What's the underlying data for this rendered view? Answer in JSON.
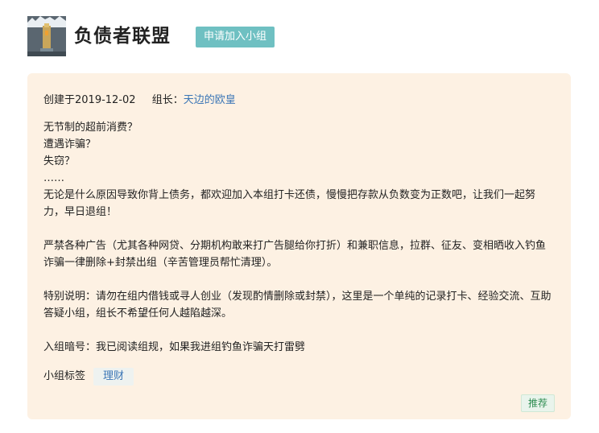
{
  "group": {
    "title": "负债者联盟",
    "join_label": "申请加入小组"
  },
  "meta": {
    "created_label": "创建于",
    "created_date": "2019-12-02",
    "leader_label": "组长：",
    "leader_name": "天边的欧皇"
  },
  "intro": {
    "lines": [
      "无节制的超前消费？",
      "遭遇诈骗？",
      "失窃？",
      "……",
      "无论是什么原因导致你背上债务，都欢迎加入本组打卡还债，慢慢把存款从负数变为正数吧，让我们一起努力，早日退组！",
      "",
      "严禁各种广告（尤其各种网贷、分期机构敢来打广告腿给你打折）和兼职信息，拉群、征友、变相晒收入钓鱼诈骗一律删除+封禁出组（辛苦管理员帮忙清理）。",
      "",
      "特别说明：请勿在组内借钱或寻人创业（发现酌情删除或封禁），这里是一个单纯的记录打卡、经验交流、互助答疑小组，组长不希望任何人越陷越深。",
      "",
      "入组暗号：我已阅读组规，如果我进组钓鱼诈骗天打雷劈"
    ]
  },
  "tags": {
    "label": "小组标签",
    "items": [
      "理财"
    ]
  },
  "recommend_label": "推荐",
  "colors": {
    "card_bg": "#fdf1e3",
    "join_button": "#6fc0c2",
    "link": "#3b76b6",
    "recommend_text": "#2f8d52"
  },
  "icons": {
    "group_avatar": "snowy-lighthouse-avatar"
  }
}
